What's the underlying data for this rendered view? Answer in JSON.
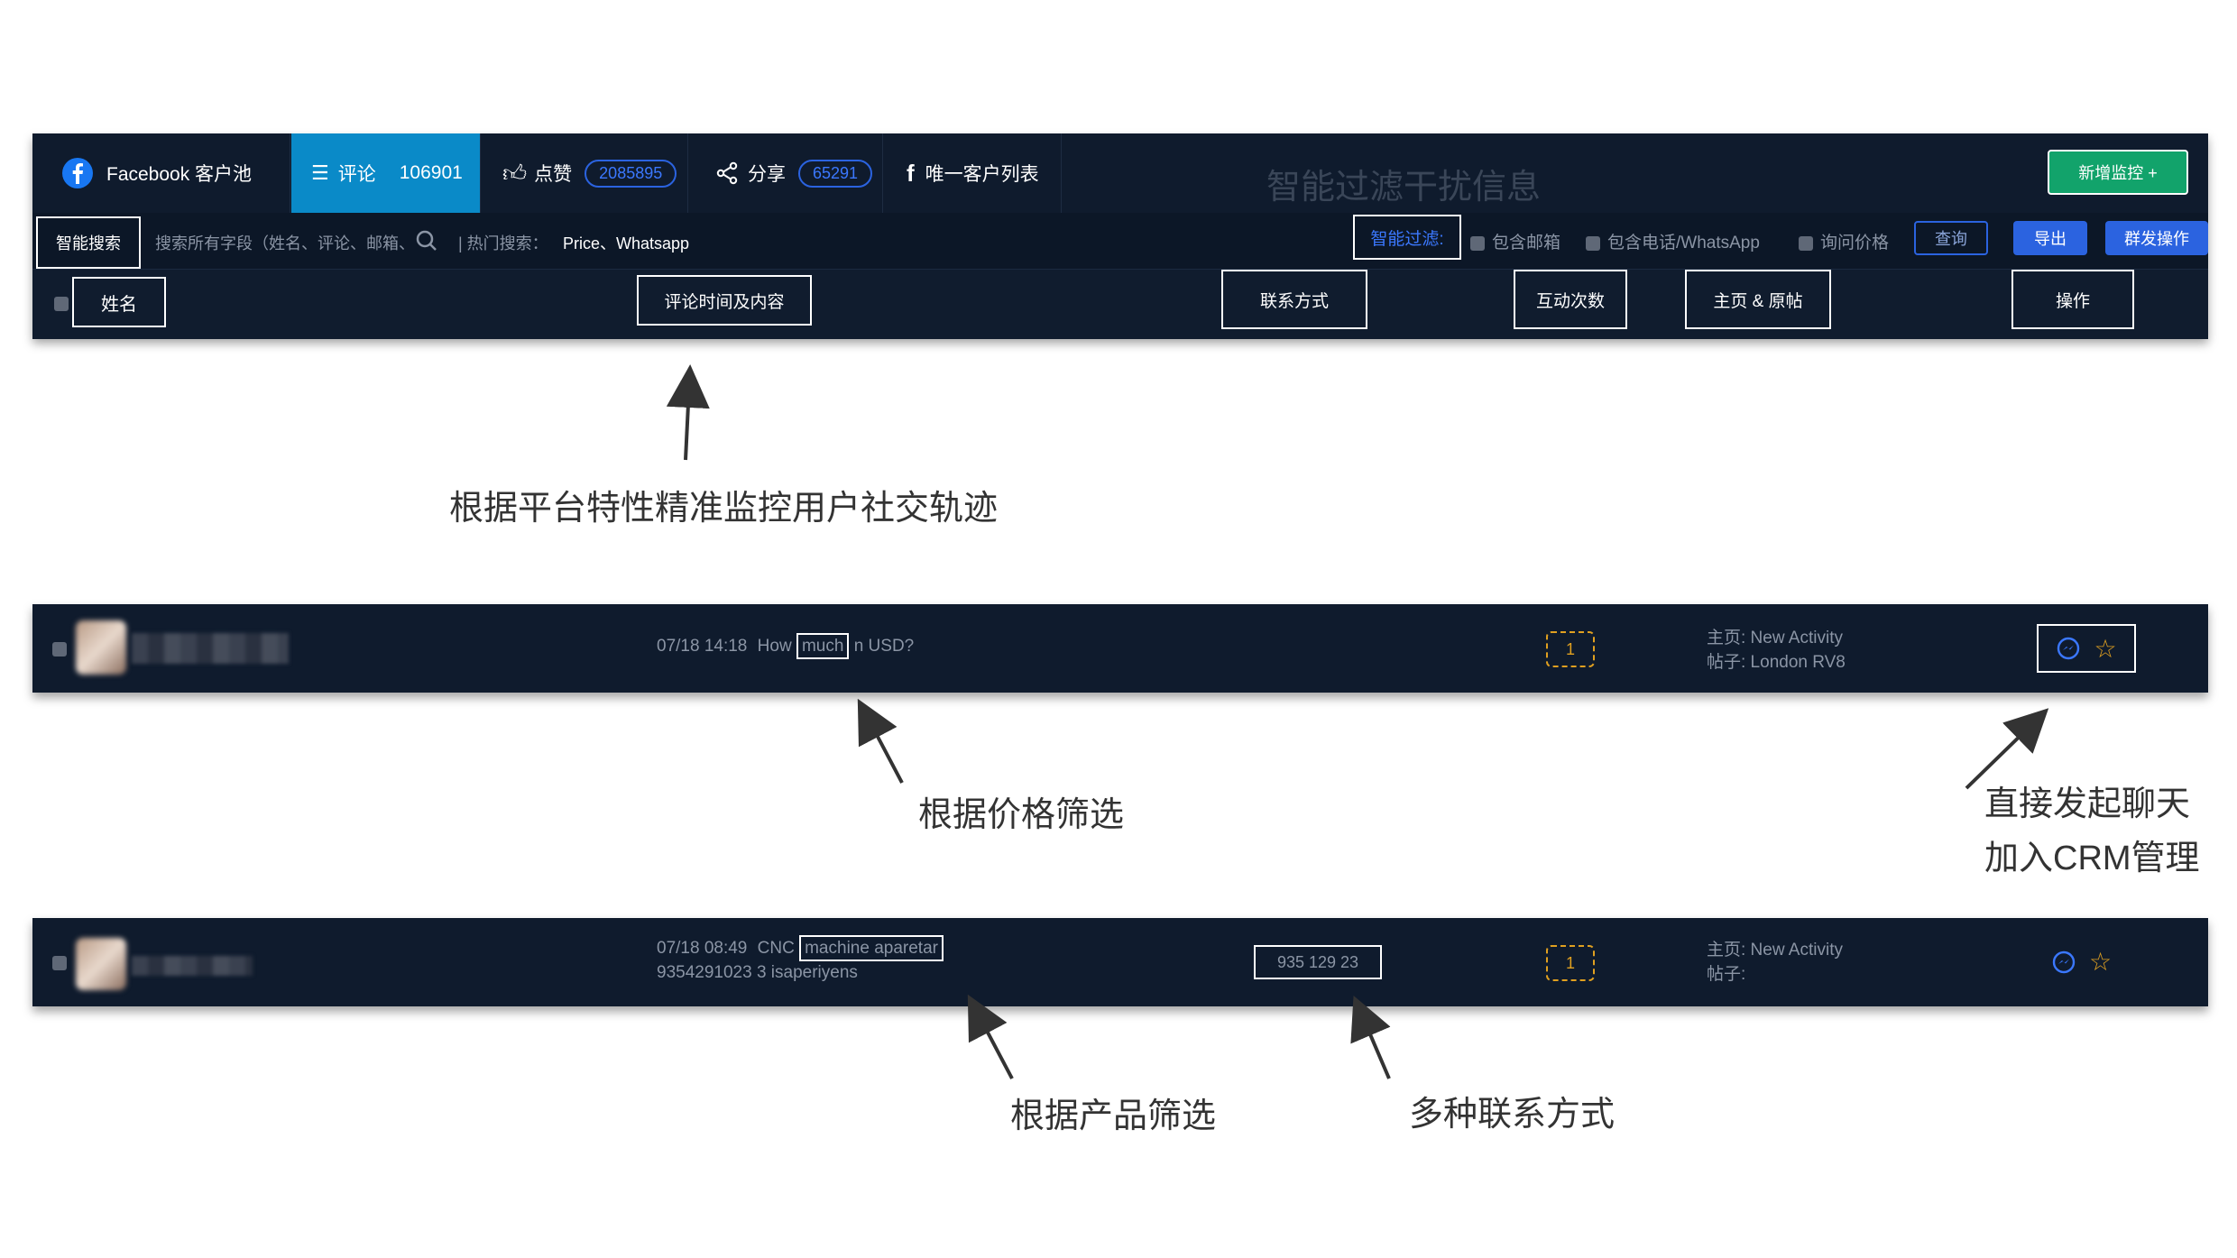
{
  "toolbar": {
    "brand": "Facebook 客户池",
    "tabs": [
      {
        "label": "评论",
        "count": "106901"
      },
      {
        "label": "点赞",
        "count": "2085895"
      },
      {
        "label": "分享",
        "count": "65291"
      },
      {
        "label": "唯一客户列表"
      }
    ],
    "new_monitor": "新增监控 +",
    "smart_search": "智能搜索",
    "search_placeholder": "搜索所有字段（姓名、评论、邮箱、",
    "hot_search_label": "| 热门搜索：",
    "hot_search_terms": "Price、Whatsapp",
    "smart_filter": "智能过滤:",
    "filters": [
      "包含邮箱",
      "包含电话/WhatsApp",
      "询问价格"
    ],
    "query_btn": "查询",
    "export_btn": "导出",
    "bulk_btn": "群发操作",
    "watermark": "智能过滤干扰信息",
    "columns": [
      "姓名",
      "评论时间及内容",
      "联系方式",
      "互动次数",
      "主页 & 原帖",
      "操作"
    ]
  },
  "rows": [
    {
      "comment_time": "07/18 14:18",
      "comment_pre": "How ",
      "comment_highlight": "much",
      "comment_post": " n USD?",
      "interactions": "1",
      "homepage": "主页: New Activity",
      "post": "帖子: London RV8"
    },
    {
      "comment_time": "07/18 08:49",
      "comment_pre": "CNC ",
      "comment_highlight": "machine aparetar",
      "comment_line2": "9354291023 3 isaperiyens",
      "contact": "935 129 23",
      "interactions": "1",
      "homepage": "主页: New Activity",
      "post": "帖子:"
    }
  ],
  "annotations": {
    "social_track": "根据平台特性精准监控用户社交轨迹",
    "price_filter": "根据价格筛选",
    "chat_line1": "直接发起聊天",
    "chat_line2": "加入CRM管理",
    "product_filter": "根据产品筛选",
    "contacts": "多种联系方式"
  },
  "colors": {
    "bg": "#0f1b2d",
    "accent_blue": "#2b63e0",
    "tab_active": "#0a8ac8",
    "green": "#12a36b",
    "orange": "#e0a020"
  }
}
